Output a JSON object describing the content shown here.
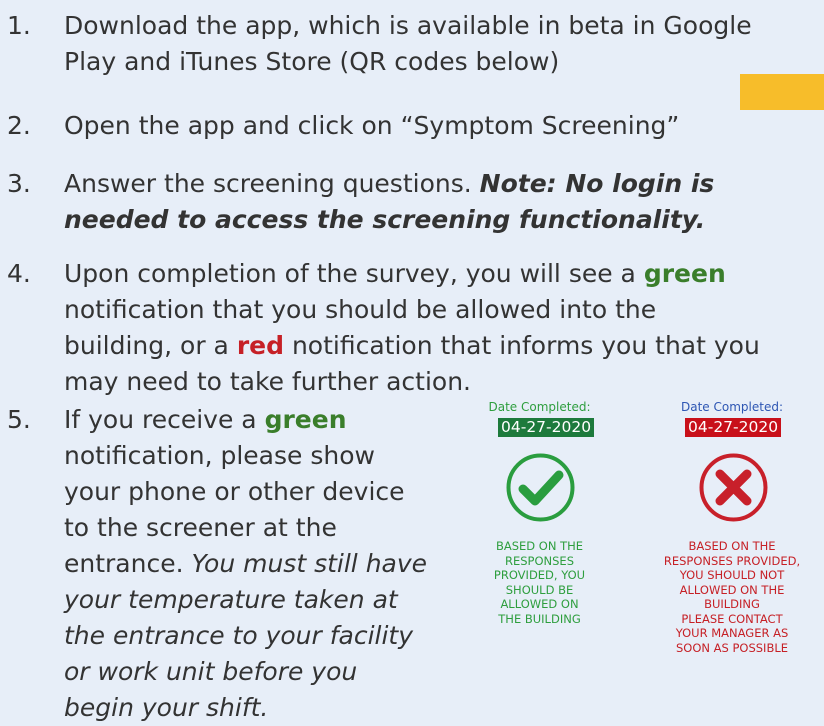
{
  "steps": [
    {
      "num": "1.",
      "lines": [
        "Download the app, which is available in beta in Google",
        "Play and iTunes Store (QR codes below)"
      ]
    },
    {
      "num": "2.",
      "text": "Open the app and click on “Symptom Screening”"
    },
    {
      "num": "3.",
      "intro": "Answer the screening questions. ",
      "note_line1": "Note: No login is",
      "note_line2": "needed to access the screening functionality."
    },
    {
      "num": "4.",
      "line1_pre": "Upon completion of the survey, you will see a ",
      "green_word": "green",
      "line2": "notification that you should be allowed into the",
      "line3_pre": "building, or a ",
      "red_word": "red",
      "line3_post": " notification that informs you that you",
      "line4": "may need to take further action."
    },
    {
      "num": "5.",
      "line1_pre": "If you receive a ",
      "green_word": "green",
      "line2": "notification, please show",
      "line3": "your phone or other device",
      "line4": "to the screener at the",
      "line5_pre": "entrance. ",
      "line5_italic": "You must still have",
      "line6": "your temperature taken at",
      "line7": "the entrance to your facility",
      "line8": "or work unit before you",
      "line9": "begin your shift."
    }
  ],
  "green_badge": {
    "date_label": "Date Completed:",
    "date_value": "04-27-2020",
    "icon": "check-icon",
    "message_lines": [
      "BASED ON THE",
      "RESPONSES",
      "PROVIDED, YOU",
      "SHOULD BE",
      "ALLOWED ON",
      "THE BUILDING"
    ]
  },
  "red_badge": {
    "date_label": "Date Completed:",
    "date_value": "04-27-2020",
    "icon": "x-icon",
    "message_lines": [
      "BASED ON THE",
      "RESPONSES PROVIDED,",
      "YOU SHOULD NOT",
      "ALLOWED ON THE",
      "BUILDING",
      "PLEASE CONTACT",
      "YOUR MANAGER AS",
      "SOON AS POSSIBLE"
    ]
  },
  "colors": {
    "background": "#e7eef8",
    "text": "#333333",
    "green": "#3a7e2b",
    "red": "#c62026",
    "orange_tab": "#f7bd2a"
  }
}
